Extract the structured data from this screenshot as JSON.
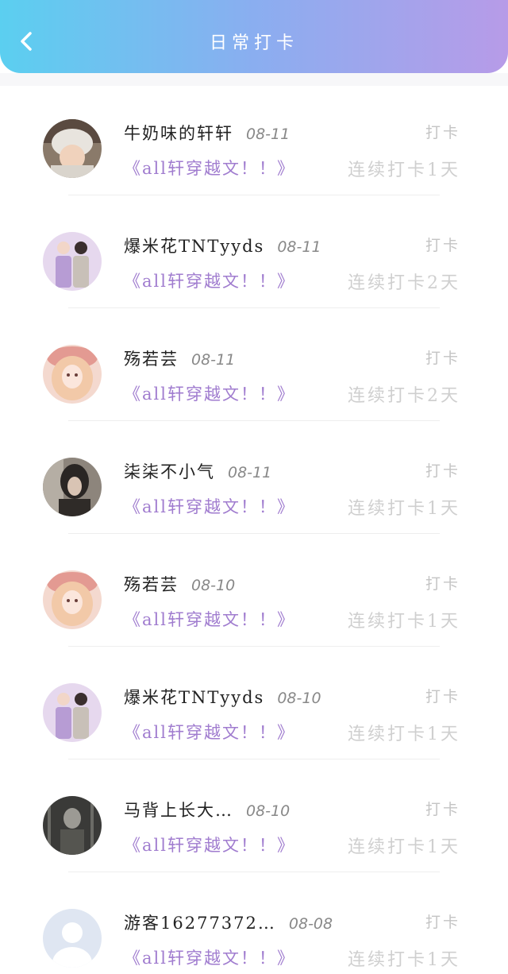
{
  "header": {
    "title": "日常打卡"
  },
  "rows": [
    {
      "name": "牛奶味的轩轩",
      "date": "08-11",
      "action": "打卡",
      "book": "《all轩穿越文！！》",
      "streak": "连续打卡1天",
      "avatar": "photo-avatar-hat"
    },
    {
      "name": "爆米花TNTyyds",
      "date": "08-11",
      "action": "打卡",
      "book": "《all轩穿越文！！》",
      "streak": "连续打卡2天",
      "avatar": "duo-avatar"
    },
    {
      "name": "殇若芸",
      "date": "08-11",
      "action": "打卡",
      "book": "《all轩穿越文！！》",
      "streak": "连续打卡2天",
      "avatar": "anime-avatar"
    },
    {
      "name": "柒柒不小气",
      "date": "08-11",
      "action": "打卡",
      "book": "《all轩穿越文！！》",
      "streak": "连续打卡1天",
      "avatar": "dark-photo-avatar"
    },
    {
      "name": "殇若芸",
      "date": "08-10",
      "action": "打卡",
      "book": "《all轩穿越文！！》",
      "streak": "连续打卡1天",
      "avatar": "anime-avatar"
    },
    {
      "name": "爆米花TNTyyds",
      "date": "08-10",
      "action": "打卡",
      "book": "《all轩穿越文！！》",
      "streak": "连续打卡1天",
      "avatar": "duo-avatar"
    },
    {
      "name": "马背上长大…",
      "date": "08-10",
      "action": "打卡",
      "book": "《all轩穿越文！！》",
      "streak": "连续打卡1天",
      "avatar": "bw-photo-avatar"
    },
    {
      "name": "游客16277372…",
      "date": "08-08",
      "action": "打卡",
      "book": "《all轩穿越文！！》",
      "streak": "连续打卡1天",
      "avatar": "default-user-avatar"
    }
  ]
}
